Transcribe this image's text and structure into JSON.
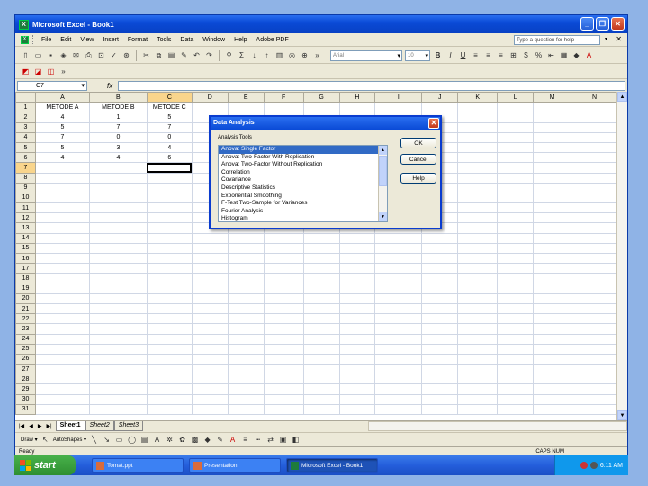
{
  "window": {
    "title": "Microsoft Excel - Book1"
  },
  "menu": {
    "items": [
      "File",
      "Edit",
      "View",
      "Insert",
      "Format",
      "Tools",
      "Data",
      "Window",
      "Help",
      "Adobe PDF"
    ],
    "help_placeholder": "Type a question for help"
  },
  "formatting": {
    "font_name": "Arial",
    "font_size": "10"
  },
  "formula_bar": {
    "name_box": "C7",
    "fx": "fx",
    "value": ""
  },
  "sheet": {
    "columns": [
      "A",
      "B",
      "C",
      "D",
      "E",
      "F",
      "G",
      "H",
      "I",
      "J",
      "K",
      "L",
      "M",
      "N"
    ],
    "rows": [
      "1",
      "2",
      "3",
      "4",
      "5",
      "6",
      "7",
      "8",
      "9",
      "10",
      "11",
      "12",
      "13",
      "14",
      "15",
      "16",
      "17",
      "18",
      "19",
      "20",
      "21",
      "22",
      "23",
      "24",
      "25",
      "26",
      "27",
      "28",
      "29",
      "30",
      "31"
    ],
    "cells": [
      [
        "METODE A",
        "METODE B",
        "METODE C"
      ],
      [
        "4",
        "1",
        "5"
      ],
      [
        "5",
        "7",
        "7"
      ],
      [
        "7",
        "0",
        "0"
      ],
      [
        "5",
        "3",
        "4"
      ],
      [
        "4",
        "4",
        "6"
      ]
    ],
    "active_cell": "C7"
  },
  "tabs": [
    "Sheet1",
    "Sheet2",
    "Sheet3"
  ],
  "drawing": {
    "draw_label": "Draw ▾",
    "autoshapes_label": "AutoShapes ▾"
  },
  "status": {
    "left": "Ready",
    "right": "CAPS NUM"
  },
  "dialog": {
    "title": "Data Analysis",
    "list_label": "Analysis Tools",
    "tools": [
      "Anova: Single Factor",
      "Anova: Two-Factor With Replication",
      "Anova: Two-Factor Without Replication",
      "Correlation",
      "Covariance",
      "Descriptive Statistics",
      "Exponential Smoothing",
      "F-Test Two-Sample for Variances",
      "Fourier Analysis",
      "Histogram"
    ],
    "selected_index": 0,
    "ok_label": "OK",
    "cancel_label": "Cancel",
    "help_label": "Help"
  },
  "taskbar": {
    "start_label": "start",
    "tasks": [
      "Tomat.ppt",
      "Presentation",
      "Microsoft Excel - Book1"
    ],
    "active_task": 2,
    "clock": "6:11 AM"
  }
}
